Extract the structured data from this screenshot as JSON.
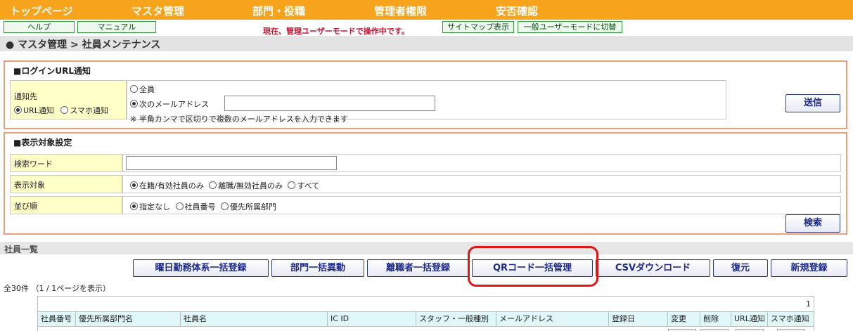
{
  "nav": {
    "items": [
      "トップページ",
      "マスタ管理",
      "部門・役職",
      "管理者権限",
      "安否確認"
    ]
  },
  "utility": {
    "help": "ヘルプ",
    "manual": "マニュアル",
    "notice": "現在、管理ユーザーモードで操作中です。",
    "sitemap": "サイトマップ表示",
    "switch_mode": "一般ユーザーモードに切替"
  },
  "breadcrumb": "● マスタ管理 > 社員メンテナンス",
  "login_notice": {
    "title": "■ログインURL通知",
    "target_label": "通知先",
    "url_option": "URL通知",
    "smartphone_option": "スマホ通知",
    "all_option": "全員",
    "email_option": "次のメールアドレス",
    "email_value": "",
    "hint": "※ 半角カンマで区切りで複数のメールアドレスを入力できます",
    "send_button": "送信"
  },
  "display_settings": {
    "title": "■表示対象設定",
    "keyword_label": "検索ワード",
    "keyword_value": "",
    "target_label": "表示対象",
    "target_options": [
      "在籍/有効社員のみ",
      "離職/無効社員のみ",
      "すべて"
    ],
    "sort_label": "並び順",
    "sort_options": [
      "指定なし",
      "社員番号",
      "優先所属部門"
    ],
    "search_button": "検索"
  },
  "employee_list": {
    "section_title": "社員一覧",
    "actions": [
      "曜日勤務体系一括登録",
      "部門一括異動",
      "離職者一括登録",
      "QRコード一括管理",
      "CSVダウンロード",
      "復元",
      "新規登録"
    ],
    "count_text": "全30件 （1 / 1ページを表示）",
    "page_number": "1",
    "columns": [
      "社員番号",
      "優先所属部門名",
      "社員名",
      "IC ID",
      "スタッフ・一般種別",
      "メールアドレス",
      "登録日",
      "変更",
      "削除",
      "URL通知",
      "スマホ通知"
    ]
  },
  "colors": {
    "nav_bg": "#f7a31c",
    "panel_border": "#e9a07a",
    "label_bg": "#ffffc8",
    "button_text": "#1c2a8c",
    "highlight": "#e41414",
    "notice": "#c4122f"
  }
}
